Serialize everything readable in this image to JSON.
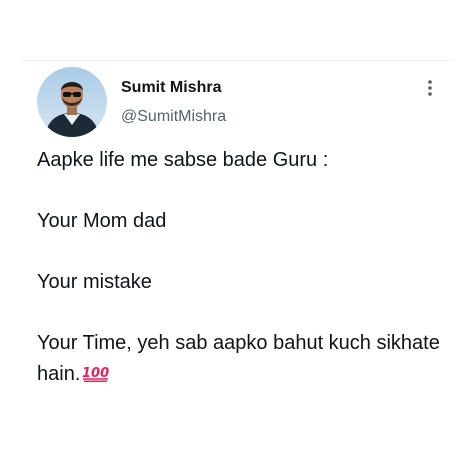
{
  "author": {
    "name": "Sumit Mishra",
    "handle": "@SumitMishra",
    "avatar_icon": "profile-photo"
  },
  "menu_icon": "more-vertical-icon",
  "tweet": {
    "lines": [
      "Aapke life me sabse bade Guru :",
      "Your Mom dad",
      "Your mistake",
      "Your Time, yeh sab aapko bahut kuch sikhate hain."
    ],
    "emoji": "💯"
  },
  "colors": {
    "text": "#0f1419",
    "secondary": "#536471",
    "emoji_red": "#e0245e"
  }
}
